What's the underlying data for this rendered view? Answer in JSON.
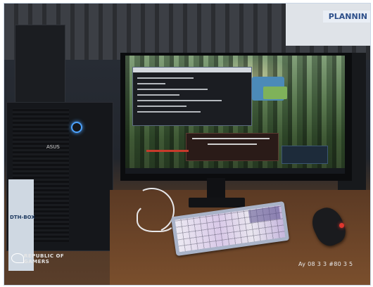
{
  "photo": {
    "wall_sign": "PLANNIN",
    "case_brand": "ASUS",
    "rog_label_line1": "REPUBLIC OF",
    "rog_label_line2": "GAMERS",
    "box_label": "DTH-BOX",
    "timestamp_overlay": "Ay 08 3 3 #80 3 5"
  },
  "colors": {
    "accent_blue": "#4da3ff",
    "mouse_led": "#e0372e",
    "keyboard_purple": "#d9c9e8"
  }
}
